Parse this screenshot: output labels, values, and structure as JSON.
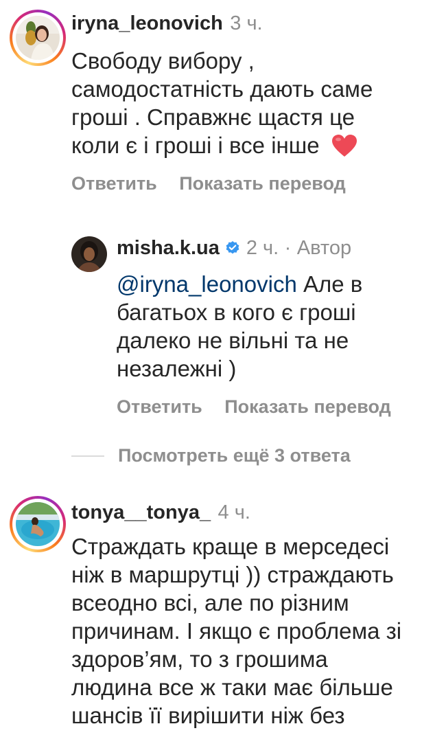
{
  "comments": [
    {
      "username": "iryna_leonovich",
      "time": "3 ч.",
      "lines": [
        "Свободу вибору ,",
        "самодостатність дають саме",
        "гроші . Справжнє щастя це",
        "коли є і гроші і все інше"
      ],
      "emoji": "❤️",
      "reply_label": "Ответить",
      "translate_label": "Показать перевод"
    },
    {
      "username": "tonya__tonya_",
      "time": "4 ч.",
      "lines": [
        "Страждать краще в мерседесі",
        "ніж в маршрутці )) страждають",
        "всеодно всі, але по різним",
        "причинам. І якщо є проблема зі",
        "здоров’ям, то з грошима",
        "людина все ж таки має більше",
        "шансів її вирішити ніж без"
      ]
    }
  ],
  "reply": {
    "username": "misha.k.ua",
    "verified_icon": "verified-badge-icon",
    "time": "2 ч.",
    "separator": "·",
    "author_label": "Автор",
    "mention": "@iryna_leonovich",
    "first_line_rest": " Але в",
    "lines": [
      "багатьох в кого є гроші",
      "далеко не вільні та не",
      "незалежні )"
    ],
    "reply_label": "Ответить",
    "translate_label": "Показать перевод"
  },
  "view_more": "Посмотреть ещё 3 ответа",
  "colors": {
    "text": "#262626",
    "secondary": "#8e8e8e",
    "mention": "#00376b",
    "verified": "#3897f0",
    "heart": "#ed4956"
  }
}
